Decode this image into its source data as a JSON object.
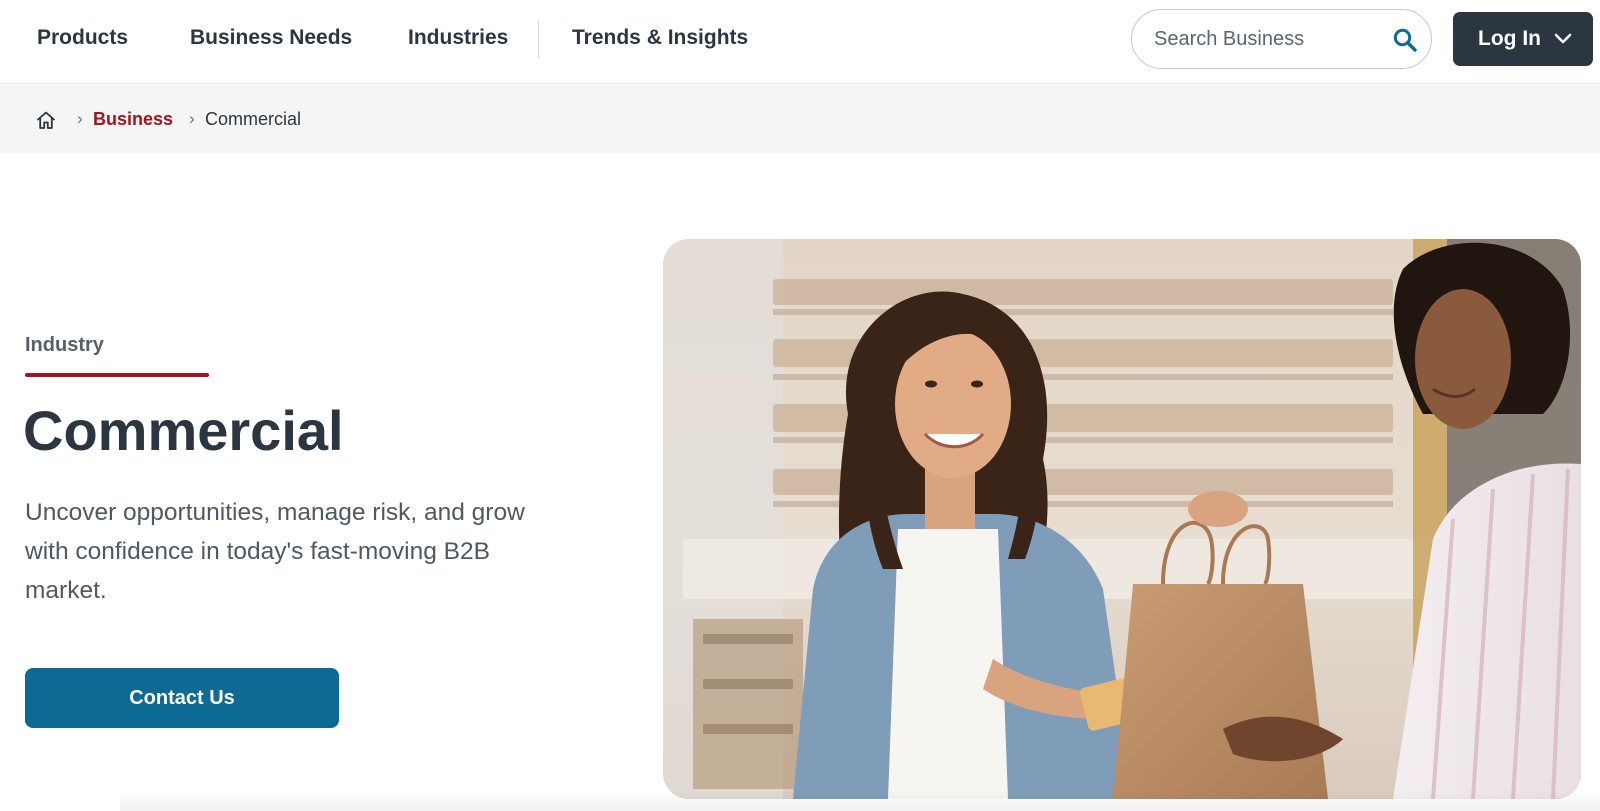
{
  "nav": {
    "items": [
      {
        "label": "Products"
      },
      {
        "label": "Business Needs"
      },
      {
        "label": "Industries"
      },
      {
        "label": "Trends & Insights"
      }
    ],
    "search": {
      "placeholder": "Search Business",
      "icon": "search-icon"
    },
    "login": {
      "label": "Log In",
      "icon": "chevron-down-icon"
    }
  },
  "breadcrumb": {
    "home_icon": "home-icon",
    "separator": "›",
    "link": "Business",
    "current": "Commercial"
  },
  "hero": {
    "eyebrow": "Industry",
    "title": "Commercial",
    "description": "Uncover opportunities, manage risk, and grow with confidence in today's fast-moving B2B market.",
    "cta": "Contact Us",
    "image": "photo of a smiling woman handing a card and paper shopping bag to another woman in a store"
  },
  "colors": {
    "accent_red": "#a3141e",
    "primary_blue": "#0c6a94",
    "dark_slate": "#2b3640"
  }
}
